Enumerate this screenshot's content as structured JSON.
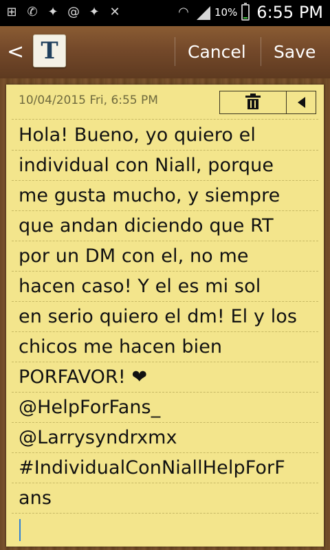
{
  "status_bar": {
    "battery_percent": "10%",
    "time": "6:55 PM",
    "icons": [
      "add-icon",
      "whatsapp-icon",
      "twitter-icon",
      "at-sign-icon",
      "twitter-icon",
      "mute-icon",
      "wifi-icon",
      "signal-icon",
      "battery-icon"
    ]
  },
  "action_bar": {
    "back_glyph": "<",
    "app_icon_letter": "T",
    "cancel_label": "Cancel",
    "save_label": "Save"
  },
  "note": {
    "date": "10/04/2015 Fri, 6:55 PM",
    "lines": [
      "Hola! Bueno, yo quiero el",
      "individual con Niall, porque",
      "me gusta mucho, y siempre",
      "que andan diciendo que RT",
      "por un DM con el, no me",
      "hacen caso!  Y el es mi sol",
      "en serio quiero el dm! El y los",
      "chicos me hacen bien",
      "PORFAVOR! ❤",
      "@HelpForFans_",
      "@Larrysyndrxmx",
      "#IndividualConNiallHelpForF",
      "ans",
      ""
    ]
  }
}
